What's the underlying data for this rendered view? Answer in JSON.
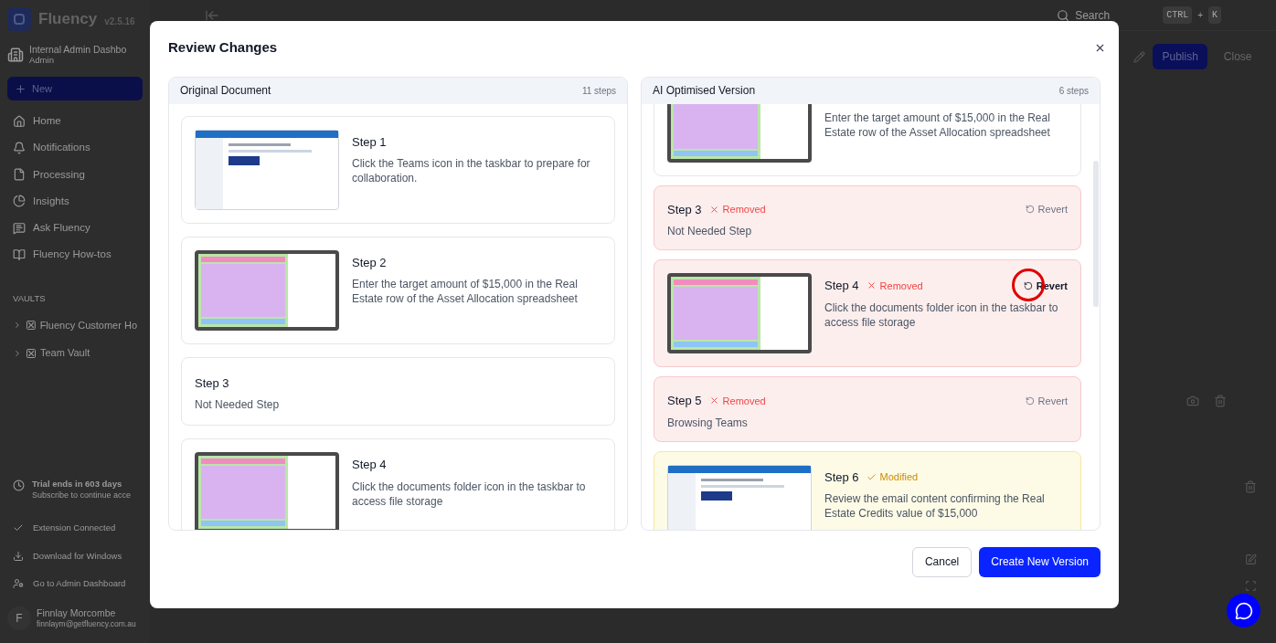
{
  "app": {
    "brand": "Fluency",
    "version": "v2.5.16",
    "workspace": {
      "name": "Internal Admin Dashbo",
      "role": "Admin"
    },
    "new_button": "New",
    "nav": [
      {
        "label": "Home"
      },
      {
        "label": "Notifications"
      },
      {
        "label": "Processing"
      },
      {
        "label": "Insights"
      },
      {
        "label": "Ask Fluency"
      },
      {
        "label": "Fluency How-tos"
      }
    ],
    "vaults_heading": "VAULTS",
    "vaults": [
      {
        "label": "Fluency Customer Ho"
      },
      {
        "label": "Team Vault"
      }
    ],
    "trial": {
      "title": "Trial ends in 603 days",
      "subtitle": "Subscribe to continue acce"
    },
    "footer_links": [
      {
        "label": "Extension Connected"
      },
      {
        "label": "Download for Windows"
      },
      {
        "label": "Go to Admin Dashboard"
      }
    ],
    "user": {
      "initial": "F",
      "name": "Finnlay Morcombe",
      "email": "finnlaym@getfluency.com.au"
    },
    "search": {
      "placeholder": "Search",
      "keys": [
        "CTRL",
        "K"
      ],
      "separator": "+"
    },
    "toolbar": [
      {
        "label": "Publish",
        "kind": "primary"
      },
      {
        "label": "Close",
        "kind": "plain"
      }
    ]
  },
  "dialog": {
    "title": "Review Changes",
    "columns": [
      {
        "title": "Original Document",
        "count": "11 steps",
        "scrolled": false,
        "steps": [
          {
            "kind": "email",
            "title": "Step 1",
            "description": "Click the Teams icon in the taskbar to prepare for collaboration."
          },
          {
            "kind": "spreadsheet",
            "title": "Step 2",
            "description": "Enter the target amount of $15,000 in the Real Estate row of the Asset Allocation spreadsheet"
          },
          {
            "kind": "text",
            "title": "Step 3",
            "description": "Not Needed Step"
          },
          {
            "kind": "spreadsheet",
            "title": "Step 4",
            "description": "Click the documents folder icon in the taskbar to access file storage"
          }
        ]
      },
      {
        "title": "AI Optimised Version",
        "count": "6 steps",
        "scrolled": true,
        "steps": [
          {
            "kind": "spreadsheet",
            "description": "Enter the target amount of $15,000 in the Real Estate row of the Asset Allocation spreadsheet",
            "removed": false,
            "modified": false
          },
          {
            "kind": "text",
            "title": "Step 3",
            "description": "Not Needed Step",
            "removed": true,
            "modified": false,
            "status_label": "Removed",
            "action": "Revert",
            "highlighted": false
          },
          {
            "kind": "spreadsheet",
            "title": "Step 4",
            "description": "Click the documents folder icon in the taskbar to access file storage",
            "removed": true,
            "modified": false,
            "status_label": "Removed",
            "action": "Revert",
            "highlighted": true
          },
          {
            "kind": "text",
            "title": "Step 5",
            "description": "Browsing Teams",
            "removed": true,
            "modified": false,
            "status_label": "Removed",
            "action": "Revert",
            "highlighted": false
          },
          {
            "kind": "email",
            "title": "Step 6",
            "description": "Review the email content confirming the Real Estate Credits value of $15,000",
            "removed": false,
            "modified": true,
            "status_label": "Modified"
          }
        ]
      }
    ],
    "buttons": [
      {
        "label": "Cancel",
        "kind": "secondary"
      },
      {
        "label": "Create New Version",
        "kind": "primary"
      }
    ]
  }
}
